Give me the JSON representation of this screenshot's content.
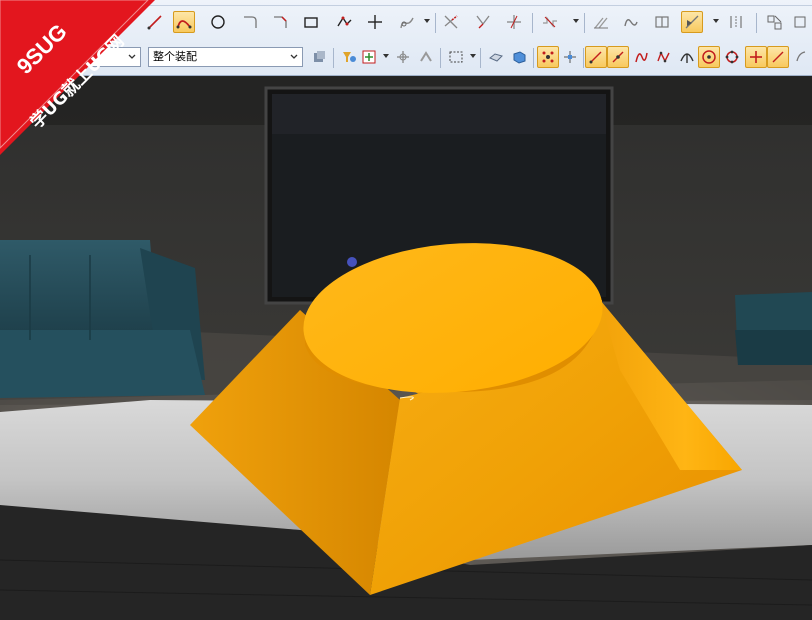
{
  "toolbar": {
    "filter_value": "",
    "assembly_scope_value": "整个装配",
    "row1_tools": [
      "line-icon",
      "arc-icon",
      "circle-icon",
      "fillet-icon",
      "chamfer-icon",
      "rectangle-icon",
      "polygon-icon",
      "point-icon",
      "studio-spline-icon",
      "quick-trim-icon",
      "quick-extend-icon",
      "make-corner-icon",
      "offset-curve-icon",
      "mirror-curve-icon",
      "derived-lines-icon",
      "intersection-icon",
      "sketch-constraint-icon",
      "dimension-icon",
      "display-constraints-icon"
    ],
    "row2_tools": [
      "part-navigator-icon",
      "type-filter-icon",
      "filter-settings-icon",
      "snap-point-icon",
      "select-region-icon",
      "feature-icon",
      "body-icon",
      "end-point-icon",
      "mid-point-icon",
      "control-point-icon",
      "intersection-point-icon",
      "arc-center-icon",
      "quadrant-point-icon",
      "on-curve-icon",
      "existing-point-icon"
    ]
  },
  "watermark": {
    "line1": "9SUG",
    "line2": "学UG就上UG网"
  },
  "colors": {
    "part": "#f5a400",
    "toolbar_bg": "#e7eef8",
    "watermark_red": "#e3161e"
  }
}
